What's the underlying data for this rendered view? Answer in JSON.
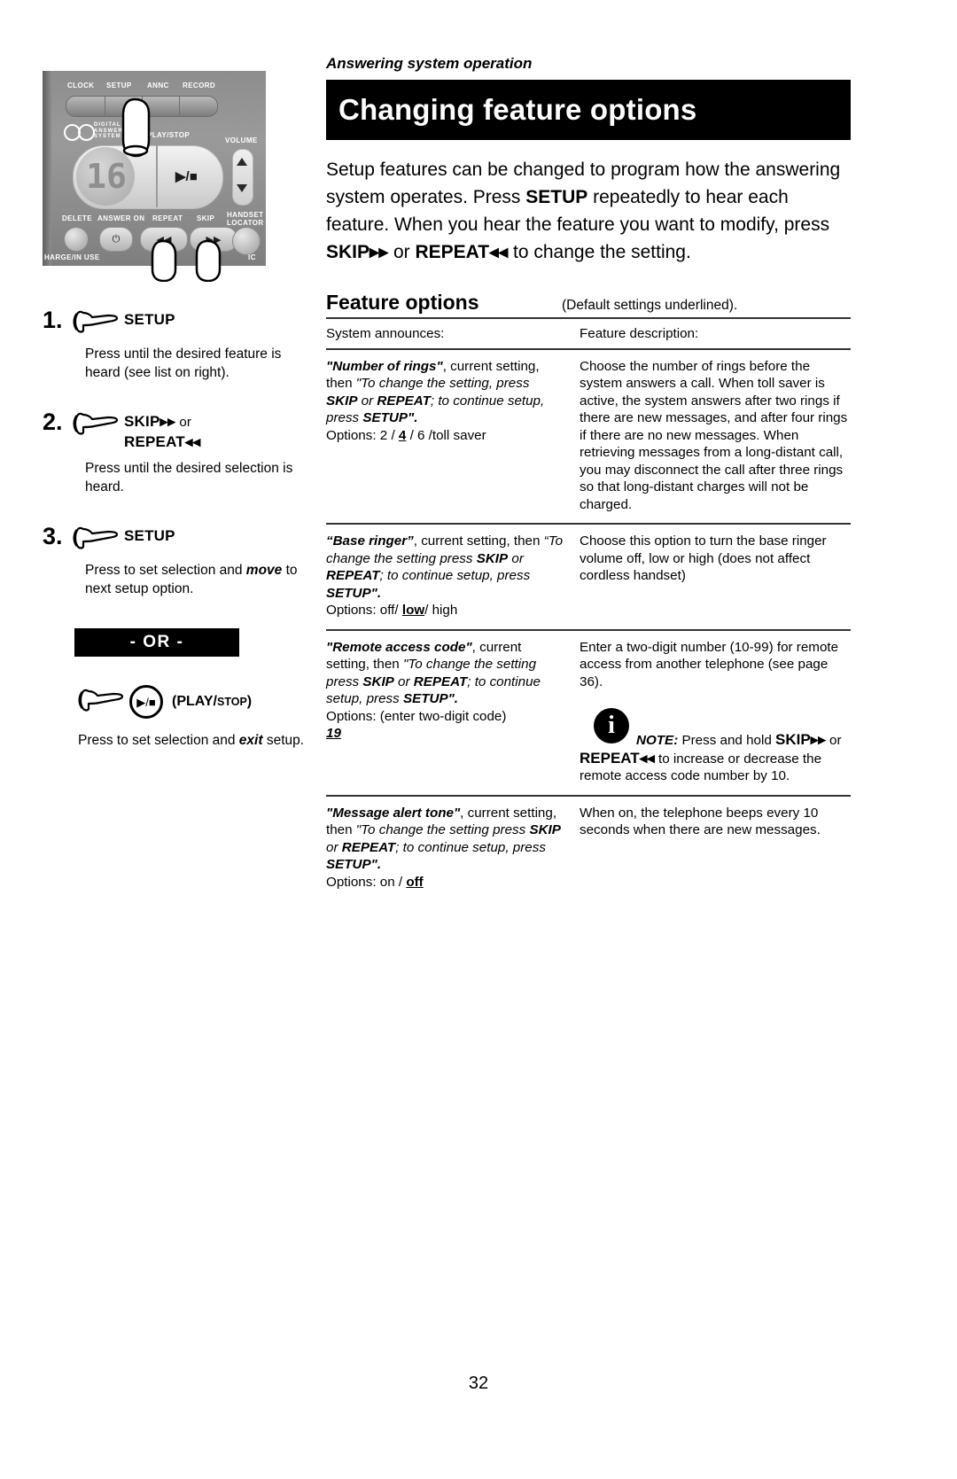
{
  "document": {
    "running_head": "Answering system operation",
    "title": "Changing feature options",
    "page_number": "32"
  },
  "intro": {
    "part1": "Setup features can be changed to program how the answering system operates. Press ",
    "setup1": "SETUP",
    "part2": " repeatedly to hear each feature. When you hear the feature you want to modify, press ",
    "skip": "SKIP",
    "skip_glyph": "▸▸",
    "part3": " or ",
    "repeat": "REPEAT",
    "repeat_glyph": "◂◂",
    "part4": " to change the setting."
  },
  "device": {
    "labels": {
      "clock": "CLOCK",
      "setup": "SETUP",
      "annc": "ANNC",
      "record": "RECORD",
      "play_stop": "PLAY/STOP",
      "volume": "VOLUME",
      "delete": "DELETE",
      "answer_on": "ANSWER ON",
      "repeat": "REPEAT",
      "skip": "SKIP",
      "handset_locator": "HANDSET LOCATOR",
      "charge_in_use": "HARGE/IN USE",
      "mic": "IC",
      "logo": "DIGITAL ANSWERING SYSTEM"
    },
    "display_value": "16",
    "play_glyph": "▶/■"
  },
  "steps": [
    {
      "number": "1.",
      "key": "SETUP",
      "key_suffix": "",
      "key_line2": "",
      "desc_before": "Press until the desired feature is heard (see list on right).",
      "desc_em": "",
      "desc_after": ""
    },
    {
      "number": "2.",
      "key": "SKIP",
      "key_glyph": "▸▸",
      "key_suffix": " or",
      "key_line2": "REPEAT",
      "key_line2_glyph": "◂◂",
      "desc_before": "Press until the desired selection is heard.",
      "desc_em": "",
      "desc_after": ""
    },
    {
      "number": "3.",
      "key": "SETUP",
      "key_suffix": "",
      "key_line2": "",
      "desc_before": "Press to set selection and ",
      "desc_em": "move",
      "desc_after": " to next setup option."
    }
  ],
  "or_divider": "- OR -",
  "play_option": {
    "label_main": "(PLAY/",
    "label_small": "STOP",
    "label_end": ")",
    "desc_before": "Press to set selection and ",
    "desc_em": "exit",
    "desc_after": " setup."
  },
  "feature_options": {
    "title": "Feature options",
    "default_note": "(Default settings underlined).",
    "columns": {
      "left": "System announces:",
      "right": "Feature description:"
    },
    "rows": [
      {
        "announce_q1": "\"Number of rings\"",
        "announce_a": ", current setting, then ",
        "announce_q2": "\"To change the setting, press ",
        "announce_skip": "SKIP",
        "announce_or": " or ",
        "announce_repeat": "REPEAT",
        "announce_tail": "; to continue setup, press ",
        "announce_setup": "SETUP\".",
        "options_label": "Options: ",
        "options_pre": "2 / ",
        "options_default": "4",
        "options_post": " / 6 /toll saver",
        "description": "Choose the number of rings before the system answers a call. When toll saver is active, the system answers after two rings if there are new messages, and after four rings if there are no new messages. When retrieving messages from a long-distant call, you may disconnect the call after three rings so that long-distant charges will not be charged."
      },
      {
        "announce_q1": "“Base ringer”",
        "announce_a": ", current setting, then ",
        "announce_q2": "“To change the setting press ",
        "announce_skip": "SKIP",
        "announce_or": " or ",
        "announce_repeat": "REPEAT",
        "announce_tail": "; to continue setup, press ",
        "announce_setup": "SETUP\".",
        "options_label": "Options: ",
        "options_pre": "off/ ",
        "options_default": "low",
        "options_post": "/ high",
        "description": "Choose this option to turn the base ringer volume off, low or high (does not affect cordless handset)"
      },
      {
        "announce_q1": "\"Remote access code\"",
        "announce_a": ", current setting, then ",
        "announce_q2": "\"To change the setting press ",
        "announce_skip": "SKIP",
        "announce_or": " or ",
        "announce_repeat": "REPEAT",
        "announce_tail": "; to continue setup, press ",
        "announce_setup": "SETUP\".",
        "options_label": "Options:  ",
        "options_pre": "(enter two-digit code) ",
        "options_default": "19",
        "options_post": "",
        "description": "Enter a two-digit number (10-99) for remote access from another telephone (see page 36).",
        "note": {
          "icon": "i",
          "label": "NOTE:",
          "text_before": " Press and hold ",
          "skip": "SKIP",
          "skip_glyph": "▸▸",
          "text_mid": " or ",
          "repeat": "REPEAT",
          "repeat_glyph": "◂◂",
          "text_after": " to increase or decrease the remote access code number by 10."
        }
      },
      {
        "announce_q1": "\"Message alert tone\"",
        "announce_a": ", current setting, then ",
        "announce_q2": "\"To change the setting press ",
        "announce_skip": "SKIP",
        "announce_or": " or ",
        "announce_repeat": "REPEAT",
        "announce_tail": "; to continue setup, press ",
        "announce_setup": "SETUP\".",
        "options_label": "Options: ",
        "options_pre": "on / ",
        "options_default": "off",
        "options_post": "",
        "description": "When on, the telephone beeps every 10 seconds when there are new messages."
      }
    ]
  }
}
